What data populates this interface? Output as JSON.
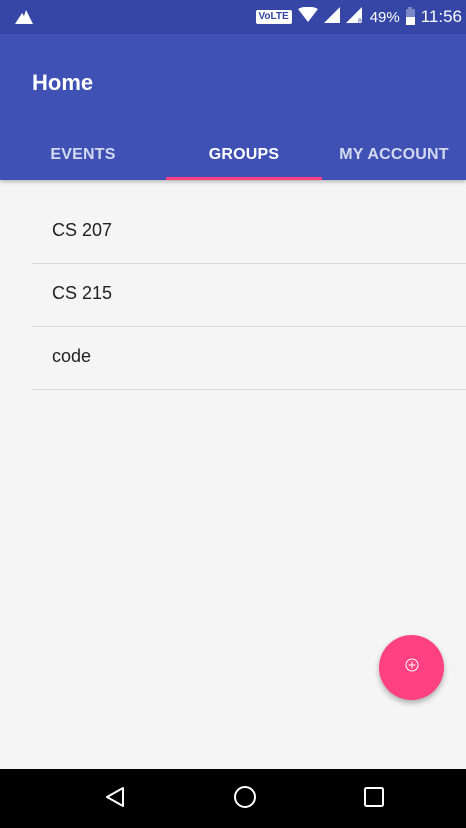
{
  "status_bar": {
    "left_icon": "notification-app-icon",
    "network_badge": "VoLTE",
    "battery_text": "49%",
    "battery_level": 0.49,
    "time": "11:56"
  },
  "app_bar": {
    "title": "Home"
  },
  "tabs": [
    {
      "label": "EVENTS",
      "active": false
    },
    {
      "label": "GROUPS",
      "active": true
    },
    {
      "label": "MY ACCOUNT",
      "active": false
    }
  ],
  "groups": [
    {
      "label": "CS 207"
    },
    {
      "label": "CS 215"
    },
    {
      "label": "code"
    }
  ],
  "fab": {
    "icon": "add-circle-icon"
  },
  "nav_bar": {
    "back_icon": "back-icon",
    "home_icon": "home-icon",
    "recents_icon": "recents-icon"
  },
  "colors": {
    "primary": "#3f51b5",
    "primary_dark": "#3546a6",
    "accent": "#ff4081",
    "background": "#f5f5f5"
  }
}
